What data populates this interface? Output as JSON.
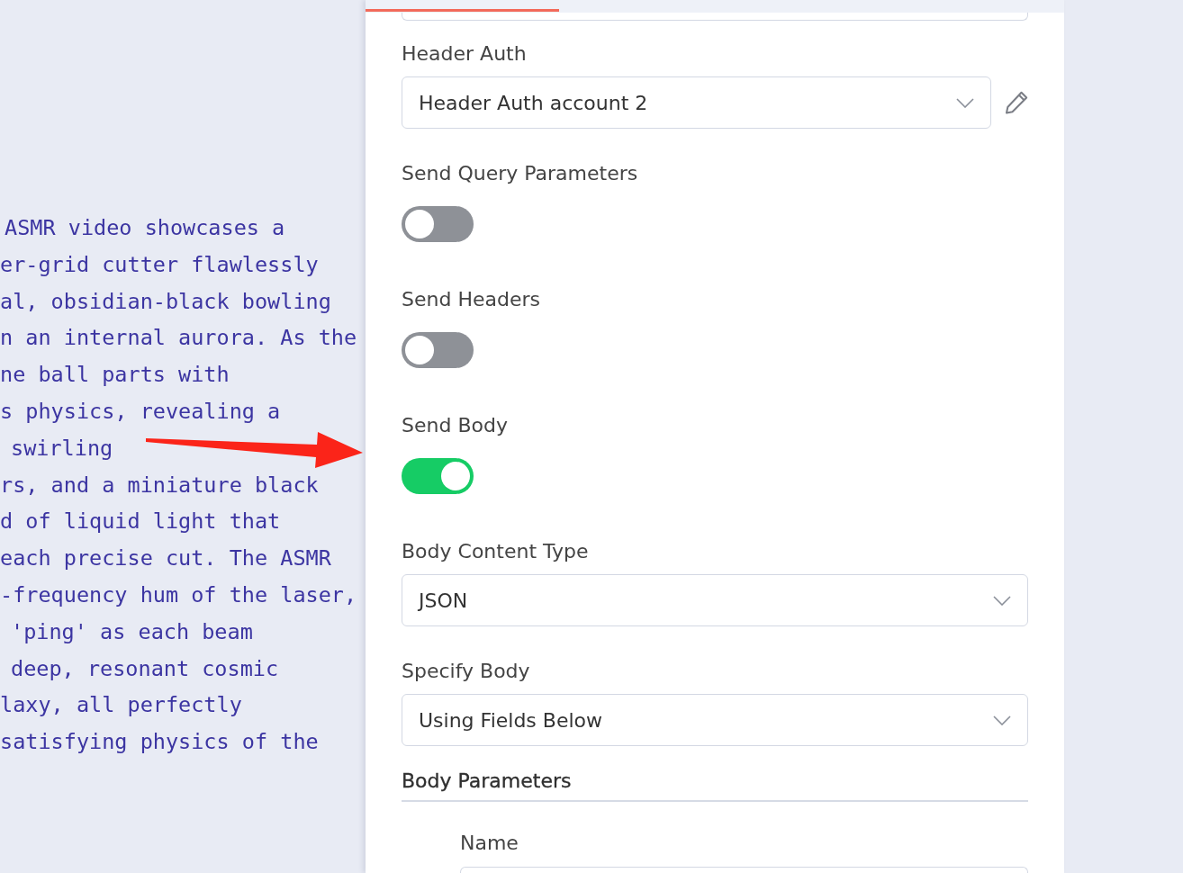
{
  "description": {
    "lines": [
      "ASMR video showcases a",
      "er-grid cutter flawlessly",
      "al, obsidian-black bowling",
      "n an internal aurora. As the",
      "ne ball parts with",
      "s physics, revealing a",
      "swirling",
      "rs, and a miniature black",
      "d of liquid light that",
      "each precise cut. The ASMR",
      "-frequency hum of the laser,",
      "'ping' as each beam",
      "deep, resonant cosmic",
      "laxy, all perfectly",
      "satisfying physics of the"
    ]
  },
  "panel": {
    "fields": [
      {
        "kind": "credential",
        "label": "Header Auth",
        "value": "Header Auth account 2"
      },
      {
        "kind": "toggle",
        "label": "Send Query Parameters",
        "on": false
      },
      {
        "kind": "toggle",
        "label": "Send Headers",
        "on": false
      },
      {
        "kind": "toggle",
        "label": "Send Body",
        "on": true
      },
      {
        "kind": "select",
        "label": "Body Content Type",
        "value": "JSON"
      },
      {
        "kind": "select",
        "label": "Specify Body",
        "value": "Using Fields Below"
      }
    ],
    "body_parameters": {
      "title": "Body Parameters",
      "fields": [
        {
          "label": "Name"
        }
      ]
    }
  }
}
